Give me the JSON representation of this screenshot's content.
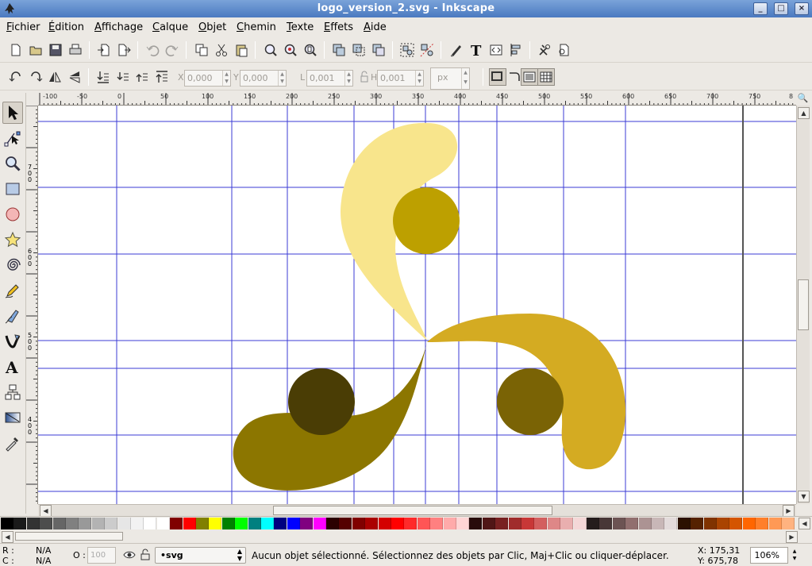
{
  "window": {
    "title": "logo_version_2.svg - Inkscape",
    "buttons": [
      "_",
      "□",
      "×"
    ]
  },
  "menu": [
    {
      "label": "Fichier"
    },
    {
      "label": "Édition"
    },
    {
      "label": "Affichage"
    },
    {
      "label": "Calque"
    },
    {
      "label": "Objet"
    },
    {
      "label": "Chemin"
    },
    {
      "label": "Texte"
    },
    {
      "label": "Effets"
    },
    {
      "label": "Aide"
    }
  ],
  "toolbar1": {
    "icons": [
      "new-icon",
      "open-icon",
      "save-icon",
      "print-icon",
      "import-icon",
      "export-icon",
      "undo-icon",
      "redo-icon",
      "copy-icon",
      "cut-icon",
      "paste-icon",
      "zoom-selection-icon",
      "zoom-drawing-icon",
      "zoom-page-icon",
      "duplicate-icon",
      "clone-icon",
      "unlink-clone-icon",
      "group-icon",
      "ungroup-icon",
      "fill-stroke-icon",
      "text-font-icon",
      "xml-editor-icon",
      "align-icon",
      "preferences-icon",
      "document-properties-icon"
    ]
  },
  "toolbar2": {
    "x_label": "X",
    "x_value": "0,000",
    "y_label": "Y",
    "y_value": "0,000",
    "w_label": "L",
    "w_value": "0,001",
    "h_label": "H",
    "h_value": "0,001",
    "unit": "px"
  },
  "ruler": {
    "h_labels": [
      "-100",
      "-50",
      "0",
      "50",
      "100",
      "150",
      "200",
      "250",
      "300",
      "350",
      "400",
      "450",
      "500",
      "550",
      "600",
      "650",
      "700",
      "750",
      "8"
    ],
    "v_labels": [
      "7\n0\n0",
      "6\n0\n0",
      "5\n0\n0",
      "4\n0\n0"
    ]
  },
  "tools": [
    "selector-icon",
    "node-icon",
    "zoom-icon",
    "rectangle-icon",
    "ellipse-icon",
    "star-icon",
    "spiral-icon",
    "pencil-icon",
    "pen-icon",
    "calligraphy-icon",
    "text-icon",
    "connector-icon",
    "gradient-icon",
    "dropper-icon"
  ],
  "shapes": {
    "colors": {
      "light": "#f8e58c",
      "mustard": "#bda000",
      "gold": "#d4ab22",
      "olive": "#8c7600",
      "dark_olive": "#7a6305",
      "darkest": "#4a3d05"
    }
  },
  "palette": [
    "#000000",
    "#1a1a1a",
    "#333333",
    "#4d4d4d",
    "#666666",
    "#808080",
    "#999999",
    "#b3b3b3",
    "#cccccc",
    "#e6e6e6",
    "#f2f2f2",
    "#ffffff",
    "#ffffff",
    "#800000",
    "#ff0000",
    "#808000",
    "#ffff00",
    "#008000",
    "#00ff00",
    "#008080",
    "#00ffff",
    "#000080",
    "#0000ff",
    "#800080",
    "#ff00ff",
    "#2b0000",
    "#550000",
    "#800000",
    "#aa0000",
    "#d40000",
    "#ff0000",
    "#ff2a2a",
    "#ff5555",
    "#ff8080",
    "#ffaaaa",
    "#ffd5d5",
    "#280b0b",
    "#501616",
    "#782121",
    "#a02c2c",
    "#c83737",
    "#d35f5f",
    "#de8787",
    "#e9afaf",
    "#f4d7d7",
    "#241c1c",
    "#483737",
    "#6c5353",
    "#916f6f",
    "#ac9393",
    "#c8b7b7",
    "#e3dbdb",
    "#2b1100",
    "#552200",
    "#803300",
    "#aa4400",
    "#d45500",
    "#ff6600",
    "#ff7f2a",
    "#ff9955",
    "#ffb380"
  ],
  "status": {
    "r_label": "R :",
    "r_value": "N/A",
    "c_label": "C :",
    "c_value": "N/A",
    "o_label": "O :",
    "o_value": "100",
    "layer": "•svg",
    "message": "Aucun objet sélectionné. Sélectionnez des objets par Clic, Maj+Clic ou cliquer-déplacer.",
    "x_coord": "X: 175,31",
    "y_coord": "Y: 675,78",
    "zoom": "106%"
  }
}
